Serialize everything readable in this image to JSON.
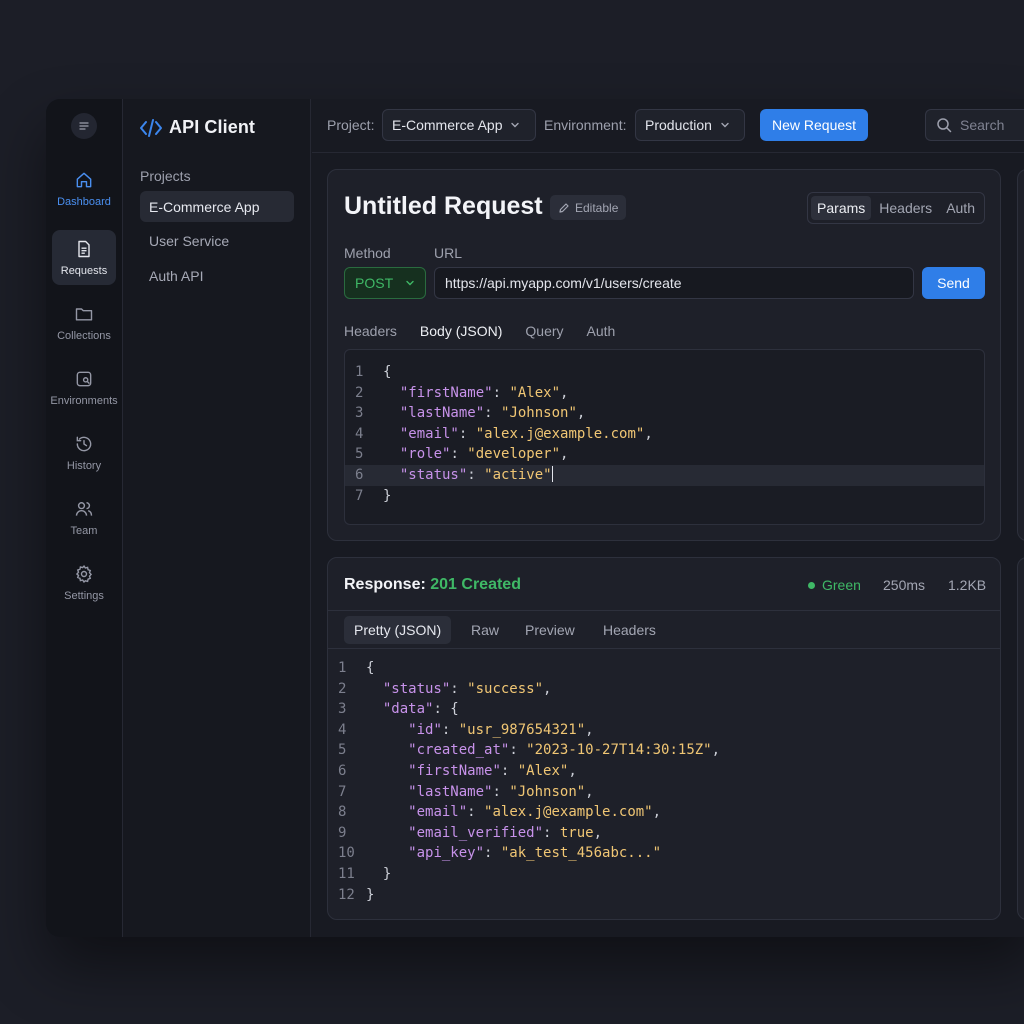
{
  "app": {
    "title": "API Client"
  },
  "rail": {
    "items": [
      {
        "label": "Dashboard",
        "icon": "home-icon"
      },
      {
        "label": "Requests",
        "icon": "document-icon"
      },
      {
        "label": "Collections",
        "icon": "folder-icon"
      },
      {
        "label": "Environments",
        "icon": "environment-icon"
      },
      {
        "label": "History",
        "icon": "history-icon"
      },
      {
        "label": "Team",
        "icon": "users-icon"
      },
      {
        "label": "Settings",
        "icon": "gear-icon"
      }
    ]
  },
  "sidebar": {
    "heading": "Projects",
    "items": [
      {
        "label": "E-Commerce App"
      },
      {
        "label": "User Service"
      },
      {
        "label": "Auth API"
      }
    ]
  },
  "topbar": {
    "project_label": "Project:",
    "project_value": "E-Commerce App",
    "environment_label": "Environment:",
    "environment_value": "Production",
    "new_request_label": "New Request",
    "search_placeholder": "Search"
  },
  "request": {
    "title": "Untitled Request",
    "editable_badge": "Editable",
    "seg_tabs": [
      "Params",
      "Headers",
      "Auth"
    ],
    "method_label": "Method",
    "url_label": "URL",
    "method": "POST",
    "url": "https://api.myapp.com/v1/users/create",
    "send_label": "Send",
    "sub_tabs": [
      "Headers",
      "Body (JSON)",
      "Query",
      "Auth"
    ],
    "body_lines": [
      {
        "n": "1",
        "parts": [
          [
            "p",
            "{"
          ]
        ]
      },
      {
        "n": "2",
        "parts": [
          [
            "p",
            "  "
          ],
          [
            "k",
            "\"firstName\""
          ],
          [
            "p",
            ": "
          ],
          [
            "s",
            "\"Alex\""
          ],
          [
            "p",
            ","
          ]
        ]
      },
      {
        "n": "3",
        "parts": [
          [
            "p",
            "  "
          ],
          [
            "k",
            "\"lastName\""
          ],
          [
            "p",
            ": "
          ],
          [
            "s",
            "\"Johnson\""
          ],
          [
            "p",
            ","
          ]
        ]
      },
      {
        "n": "4",
        "parts": [
          [
            "p",
            "  "
          ],
          [
            "k",
            "\"email\""
          ],
          [
            "p",
            ": "
          ],
          [
            "s",
            "\"alex.j@example.com\""
          ],
          [
            "p",
            ","
          ]
        ]
      },
      {
        "n": "5",
        "parts": [
          [
            "p",
            "  "
          ],
          [
            "k",
            "\"role\""
          ],
          [
            "p",
            ": "
          ],
          [
            "s",
            "\"developer\""
          ],
          [
            "p",
            ","
          ]
        ]
      },
      {
        "n": "6",
        "parts": [
          [
            "p",
            "  "
          ],
          [
            "k",
            "\"status\""
          ],
          [
            "p",
            ": "
          ],
          [
            "s",
            "\"active\""
          ]
        ],
        "highlight": true
      },
      {
        "n": "7",
        "parts": [
          [
            "p",
            "}"
          ]
        ]
      }
    ]
  },
  "response": {
    "label": "Response:",
    "status": "201 Created",
    "health": "Green",
    "time": "250ms",
    "size": "1.2KB",
    "tabs": [
      "Pretty (JSON)",
      "Raw",
      "Preview",
      "Headers"
    ],
    "body_lines": [
      {
        "n": "1",
        "parts": [
          [
            "p",
            "{"
          ]
        ]
      },
      {
        "n": "2",
        "parts": [
          [
            "p",
            "  "
          ],
          [
            "k",
            "\"status\""
          ],
          [
            "p",
            ": "
          ],
          [
            "s",
            "\"success\""
          ],
          [
            "p",
            ","
          ]
        ]
      },
      {
        "n": "3",
        "parts": [
          [
            "p",
            "  "
          ],
          [
            "k",
            "\"data\""
          ],
          [
            "p",
            ": {"
          ]
        ]
      },
      {
        "n": "4",
        "parts": [
          [
            "p",
            "     "
          ],
          [
            "k",
            "\"id\""
          ],
          [
            "p",
            ": "
          ],
          [
            "s",
            "\"usr_987654321\""
          ],
          [
            "p",
            ","
          ]
        ]
      },
      {
        "n": "5",
        "parts": [
          [
            "p",
            "     "
          ],
          [
            "k",
            "\"created_at\""
          ],
          [
            "p",
            ": "
          ],
          [
            "s",
            "\"2023-10-27T14:30:15Z\""
          ],
          [
            "p",
            ","
          ]
        ]
      },
      {
        "n": "6",
        "parts": [
          [
            "p",
            "     "
          ],
          [
            "k",
            "\"firstName\""
          ],
          [
            "p",
            ": "
          ],
          [
            "s",
            "\"Alex\""
          ],
          [
            "p",
            ","
          ]
        ]
      },
      {
        "n": "7",
        "parts": [
          [
            "p",
            "     "
          ],
          [
            "k",
            "\"lastName\""
          ],
          [
            "p",
            ": "
          ],
          [
            "s",
            "\"Johnson\""
          ],
          [
            "p",
            ","
          ]
        ]
      },
      {
        "n": "8",
        "parts": [
          [
            "p",
            "     "
          ],
          [
            "k",
            "\"email\""
          ],
          [
            "p",
            ": "
          ],
          [
            "s",
            "\"alex.j@example.com\""
          ],
          [
            "p",
            ","
          ]
        ]
      },
      {
        "n": "9",
        "parts": [
          [
            "p",
            "     "
          ],
          [
            "k",
            "\"email_verified\""
          ],
          [
            "p",
            ": "
          ],
          [
            "kw",
            "true"
          ],
          [
            "p",
            ","
          ]
        ]
      },
      {
        "n": "10",
        "parts": [
          [
            "p",
            "     "
          ],
          [
            "k",
            "\"api_key\""
          ],
          [
            "p",
            ": "
          ],
          [
            "s",
            "\"ak_test_456abc...\""
          ]
        ]
      },
      {
        "n": "11",
        "parts": [
          [
            "p",
            "  }"
          ]
        ]
      },
      {
        "n": "12",
        "parts": [
          [
            "p",
            "}"
          ]
        ]
      }
    ]
  },
  "colors": {
    "accent": "#2f7ee8",
    "success": "#3fb866",
    "json_key": "#c792ea",
    "json_string": "#f0c674"
  }
}
